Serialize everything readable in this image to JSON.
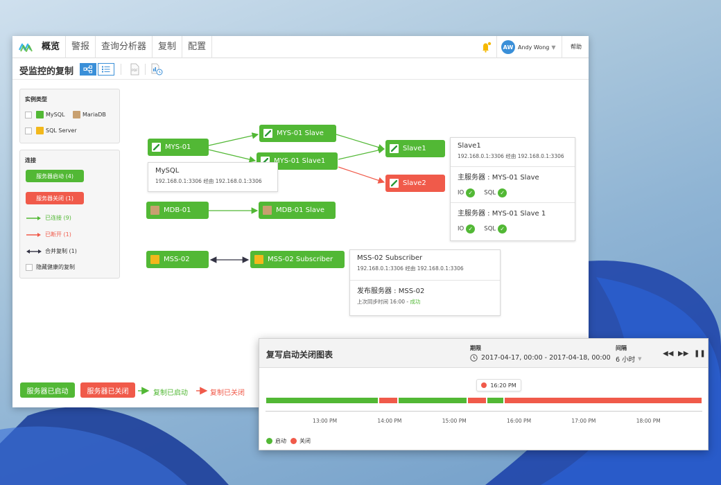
{
  "nav": {
    "items": [
      "概览",
      "警报",
      "查询分析器",
      "复制",
      "配置"
    ],
    "active_index": 0
  },
  "user": {
    "initials": "AW",
    "name": "Andy Wong"
  },
  "help_label": "帮助",
  "page": {
    "title": "受监控的复制"
  },
  "filters": {
    "instance_type_title": "实例类型",
    "types": [
      "MySQL",
      "MariaDB",
      "SQL Server"
    ],
    "connection_title": "连接",
    "server_up_label": "服务器启动 (4)",
    "server_down_label": "服务器关闭 (1)",
    "connected_label": "已连接 (9)",
    "disconnected_label": "已断开 (1)",
    "merge_label": "合并复制 (1)",
    "hide_healthy_label": "隐藏健康的复制"
  },
  "nodes": {
    "mys01": "MYS-01",
    "mys01_slave": "MYS-01 Slave",
    "mys01_slave1": "MYS-01 Slave1",
    "slave1": "Slave1",
    "slave2": "Slave2",
    "mdb01": "MDB-01",
    "mdb01_slave": "MDB-01 Slave",
    "mss02": "MSS-02",
    "mss02_sub": "MSS-02 Subscriber"
  },
  "info_mysql": {
    "title": "MySQL",
    "addr": "192.168.0.1:3306 经由 192.168.0.1:3306"
  },
  "info_slave1": {
    "title": "Slave1",
    "addr": "192.168.0.1:3306 经由 192.168.0.1:3306",
    "master1": "主服务器 : MYS-01 Slave",
    "master2": "主服务器 : MYS-01 Slave 1",
    "io_label": "IO",
    "sql_label": "SQL"
  },
  "info_mss": {
    "title": "MSS-02 Subscriber",
    "addr": "192.168.0.1:3306 经由 192.168.0.1:3306",
    "publisher": "发布服务器 : MSS-02",
    "last_sync": "上次同步时间 16:00 - ",
    "last_sync_status": "成功"
  },
  "legend": {
    "started": "服务器已启动",
    "stopped": "服务器已关闭",
    "rep_started": "复制已启动",
    "rep_stopped": "复制已关闭"
  },
  "chart": {
    "title": "复写启动关闭图表",
    "period_label": "期限",
    "period_value": "2017-04-17, 00:00 - 2017-04-18, 00:00",
    "interval_label": "间隔",
    "interval_value": "6 小时",
    "pin_label": "16:20 PM",
    "legend_up": "启动",
    "legend_down": "关闭",
    "colors": {
      "up": "#52b835",
      "down": "#f05a4a"
    }
  },
  "chart_data": {
    "type": "timeline",
    "x_ticks": [
      "13:00 PM",
      "14:00 PM",
      "15:00 PM",
      "16:00 PM",
      "17:00 PM",
      "18:00 PM"
    ],
    "segments": [
      {
        "state": "启动",
        "start": "12:05",
        "end": "13:50"
      },
      {
        "state": "关闭",
        "start": "13:50",
        "end": "14:08"
      },
      {
        "state": "启动",
        "start": "14:08",
        "end": "15:12"
      },
      {
        "state": "关闭",
        "start": "15:12",
        "end": "15:30"
      },
      {
        "state": "启动",
        "start": "15:30",
        "end": "15:46"
      },
      {
        "state": "关闭",
        "start": "15:46",
        "end": "18:50"
      }
    ]
  }
}
